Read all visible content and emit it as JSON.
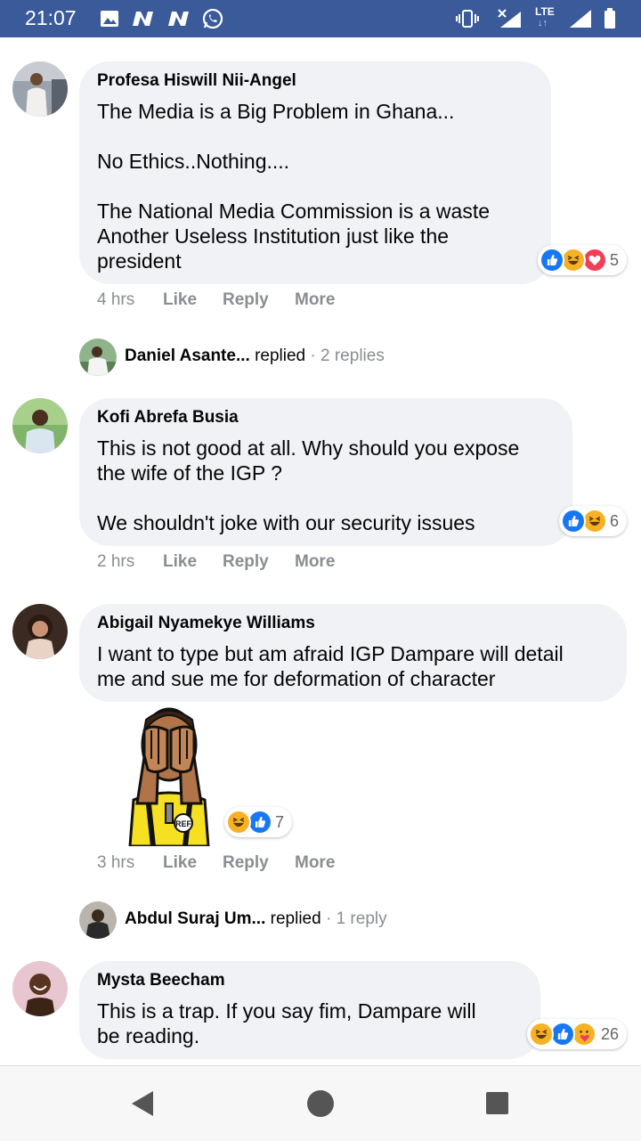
{
  "status_bar": {
    "time": "21:07",
    "notification_icons": [
      "gallery-icon",
      "n-icon",
      "n-icon",
      "whatsapp-icon"
    ],
    "network_label": "LTE",
    "system_icons": [
      "vibrate-icon",
      "no-signal-icon",
      "signal-icon",
      "battery-icon"
    ]
  },
  "comments": [
    {
      "author": "Profesa Hiswill Nii-Angel",
      "text": "The Media is a Big Problem in Ghana...\n\nNo Ethics..Nothing....\n\nThe National Media Commission is a waste\nAnother Useless Institution just like the\npresident",
      "time": "4 hrs",
      "reactions": [
        "like",
        "haha",
        "love"
      ],
      "reaction_count": "5"
    },
    {
      "author": "Kofi Abrefa Busia",
      "text": "This is not good at all. Why should you expose\nthe wife of the IGP ?\n\nWe shouldn't joke with our security issues",
      "time": "2 hrs",
      "reactions": [
        "like",
        "haha"
      ],
      "reaction_count": "6"
    },
    {
      "author": "Abigail Nyamekye Williams",
      "text": "I want to type but am afraid IGP Dampare will detail\nme and sue me for deformation of character",
      "time": "3 hrs",
      "reactions": [
        "haha",
        "like"
      ],
      "reaction_count": "7",
      "sticker_label": "REF"
    },
    {
      "author": "Mysta Beecham",
      "text": "This is a trap. If you say fim, Dampare will\nbe reading.",
      "reactions": [
        "haha",
        "like",
        "care"
      ],
      "reaction_count": "26"
    }
  ],
  "reply_threads": [
    {
      "name": "Daniel Asante...",
      "verb": "replied",
      "count": "· 2 replies"
    },
    {
      "name": "Abdul Suraj Um...",
      "verb": "replied",
      "count": "· 1 reply"
    }
  ],
  "actions": {
    "like": "Like",
    "reply": "Reply",
    "more": "More"
  },
  "colors": {
    "status_bar": "#3b5a9a",
    "bubble": "#f0f2f5",
    "meta_text": "#8a8d91",
    "like_blue": "#1877f2",
    "haha_yellow": "#f7b125",
    "love_red": "#f33e58"
  },
  "nav_bar": {
    "buttons": [
      "back-icon",
      "home-icon",
      "recents-icon"
    ]
  }
}
